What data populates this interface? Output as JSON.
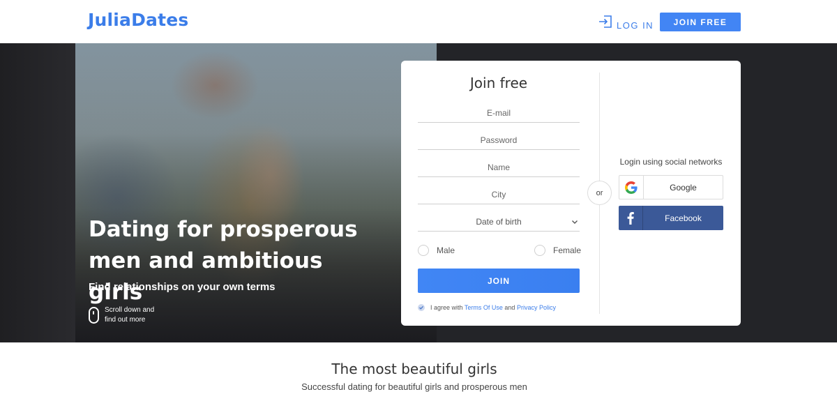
{
  "header": {
    "logo": "JuliaDates",
    "login_label": "LOG IN",
    "join_label": "JOIN FREE"
  },
  "hero": {
    "title": "Dating for prosperous men and ambitious girls",
    "subtitle": "Find relationships on your own terms",
    "scroll_line1": "Scroll down and",
    "scroll_line2": "find out more"
  },
  "form": {
    "title": "Join free",
    "email_placeholder": "E-mail",
    "password_placeholder": "Password",
    "name_placeholder": "Name",
    "city_placeholder": "City",
    "dob_label": "Date of birth",
    "gender_male": "Male",
    "gender_female": "Female",
    "join_label": "JOIN",
    "agree_text": "I agree with",
    "terms_link": "Terms Of Use",
    "and_text": "and",
    "privacy_link": "Privacy Policy",
    "agree_checked": true
  },
  "social": {
    "or_text": "or",
    "label": "Login using social networks",
    "google_label": "Google",
    "facebook_label": "Facebook"
  },
  "section": {
    "title": "The most beautiful girls",
    "subtitle": "Successful dating for beautiful girls and prosperous men"
  },
  "colors": {
    "brand": "#3b7de9",
    "button": "#4285f4",
    "facebook": "#3b5998",
    "hero_bg": "#232428"
  },
  "icons": {
    "login": "login-arrow-icon",
    "scroll": "mouse-icon",
    "dropdown": "chevron-down-icon",
    "google": "google-icon",
    "facebook": "facebook-icon",
    "check": "check-icon"
  }
}
